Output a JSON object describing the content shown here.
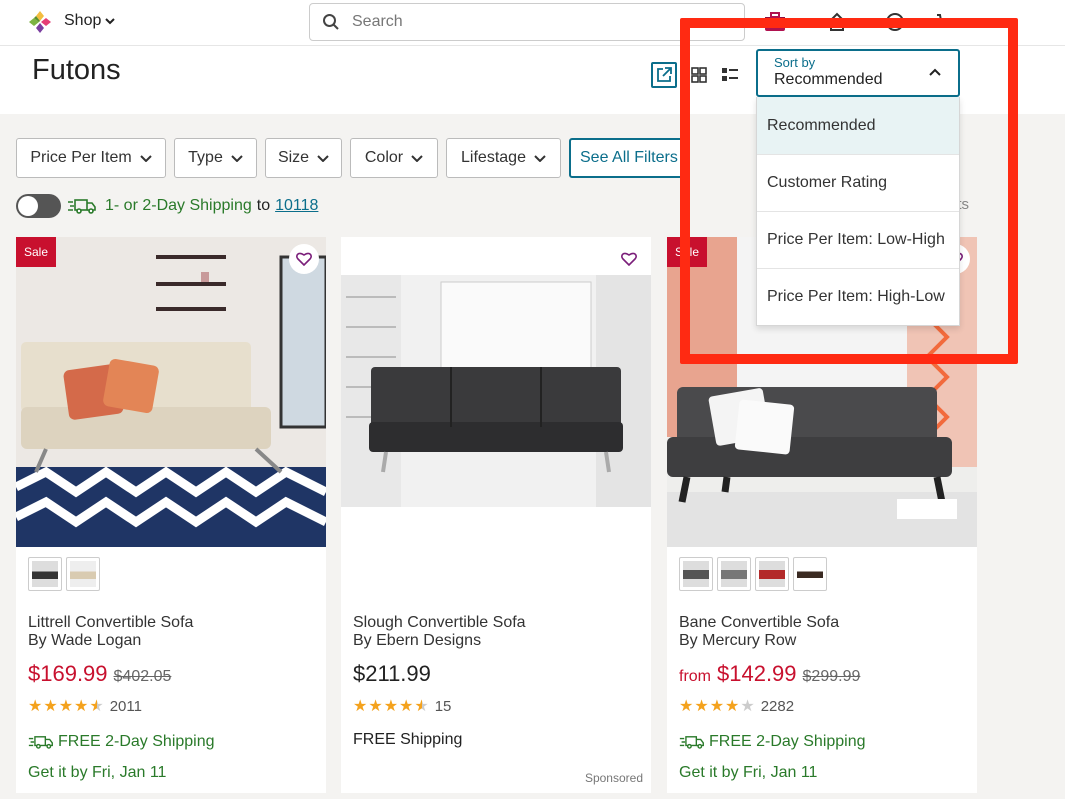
{
  "nav": {
    "shop_label": "Shop",
    "search_placeholder": "Search"
  },
  "header": {
    "title": "Futons",
    "sort": {
      "label": "Sort by",
      "value": "Recommended",
      "options": [
        "Recommended",
        "Customer Rating",
        "Price Per Item: Low-High",
        "Price Per Item: High-Low"
      ]
    }
  },
  "filters": [
    "Price Per Item",
    "Type",
    "Size",
    "Color",
    "Lifestage",
    "See All Filters"
  ],
  "shipping_bar": {
    "text": "1- or 2-Day Shipping",
    "to": "to",
    "zip": "10118",
    "results_fragment": "lts"
  },
  "products": [
    {
      "badge": "Sale",
      "name": "Littrell Convertible Sofa",
      "brand": "By Wade Logan",
      "price": "$169.99",
      "was": "$402.05",
      "rating": 4.5,
      "reviews": "2011",
      "shipping": "FREE 2-Day Shipping",
      "delivery": "Get it by Fri, Jan 11"
    },
    {
      "name": "Slough Convertible Sofa",
      "brand": "By Ebern Designs",
      "price": "$211.99",
      "rating": 4.5,
      "reviews": "15",
      "shipping": "FREE Shipping",
      "sponsored": "Sponsored"
    },
    {
      "badge": "Sale",
      "from": "from",
      "name": "Bane Convertible Sofa",
      "brand": "By Mercury Row",
      "price": "$142.99",
      "was": "$299.99",
      "rating": 4,
      "reviews": "2282",
      "shipping": "FREE 2-Day Shipping",
      "delivery": "Get it by Fri, Jan 11"
    }
  ],
  "colors": {
    "accent": "#0b6e8b",
    "sale": "#c8102e",
    "shipping_green": "#2a7a2a",
    "annotation": "#ff2a12"
  }
}
